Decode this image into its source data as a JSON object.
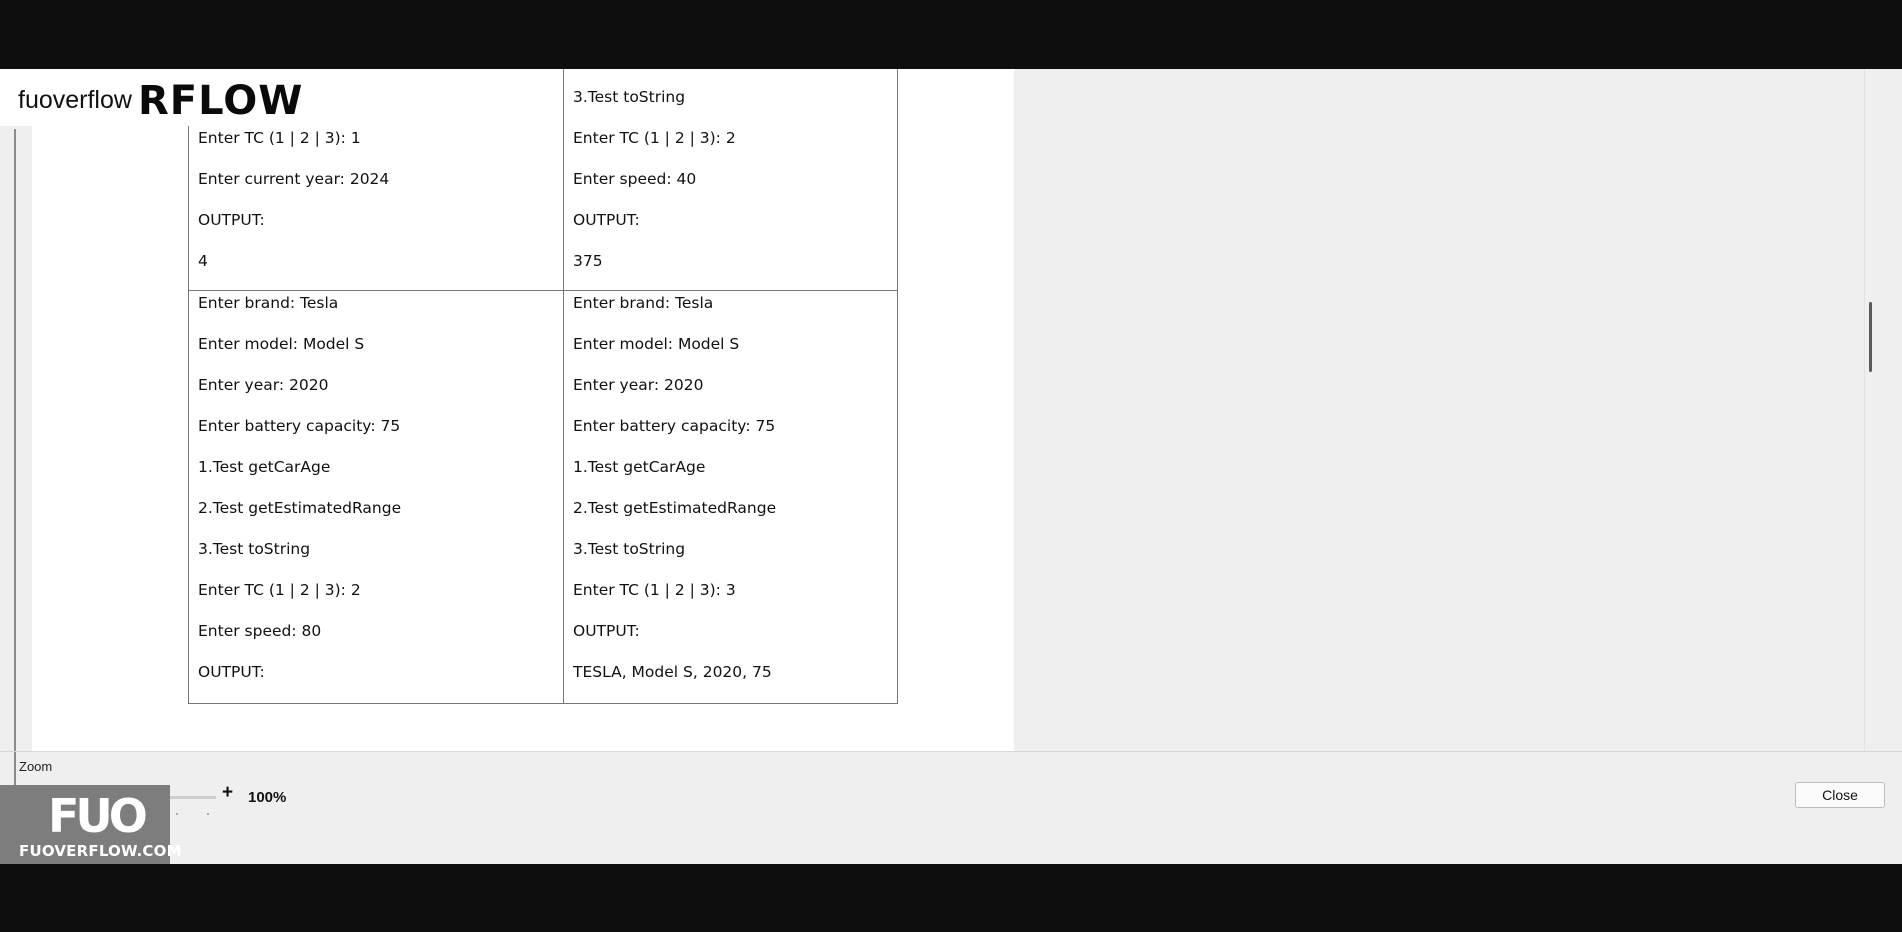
{
  "brand": {
    "small": "fuoverflow",
    "big": "RFLOW"
  },
  "document": {
    "top_left": [
      "Enter TC (1 | 2 | 3): 1",
      "Enter current year: 2024",
      "OUTPUT:",
      "4"
    ],
    "top_right": [
      "3.Test toString",
      "Enter TC (1 | 2 | 3): 2",
      "Enter speed: 40",
      "OUTPUT:",
      "375"
    ],
    "bottom_left": [
      "Enter brand: Tesla",
      "Enter model: Model S",
      "Enter year: 2020",
      "Enter battery capacity: 75",
      "1.Test getCarAge",
      "2.Test getEstimatedRange",
      "3.Test toString",
      "Enter TC (1 | 2 | 3): 2",
      "Enter speed: 80",
      "OUTPUT:"
    ],
    "bottom_right": [
      "Enter brand: Tesla",
      "Enter model: Model S",
      "Enter year: 2020",
      "Enter battery capacity: 75",
      "1.Test getCarAge",
      "2.Test getEstimatedRange",
      "3.Test toString",
      "Enter TC (1 | 2 | 3): 3",
      "OUTPUT:",
      "TESLA, Model S, 2020, 75"
    ]
  },
  "zoom": {
    "label": "Zoom",
    "minus": "-",
    "plus": "+",
    "value": "100%",
    "slider_fraction": 0.48
  },
  "close_label": "Close",
  "watermark": {
    "logo": "FUO",
    "text": "FUOVERFLOW.COM"
  }
}
